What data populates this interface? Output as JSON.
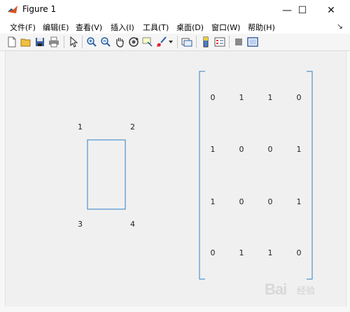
{
  "window": {
    "title": "Figure 1",
    "controls": {
      "minimize": "—",
      "maximize": "☐",
      "close": "✕"
    }
  },
  "menubar": {
    "items": [
      {
        "label": "文件(F)"
      },
      {
        "label": "编辑(E)"
      },
      {
        "label": "查看(V)"
      },
      {
        "label": "插入(I)"
      },
      {
        "label": "工具(T)"
      },
      {
        "label": "桌面(D)"
      },
      {
        "label": "窗口(W)"
      },
      {
        "label": "帮助(H)"
      }
    ],
    "overflow_arrow": "↘"
  },
  "toolbar": {
    "icons": [
      "new-figure-icon",
      "open-file-icon",
      "save-icon",
      "print-icon",
      "select-arrow-icon",
      "zoom-in-icon",
      "zoom-out-icon",
      "pan-hand-icon",
      "rotate-3d-icon",
      "data-cursor-icon",
      "brush-icon",
      "dropdown-icon",
      "link-plot-icon",
      "insert-colorbar-icon",
      "insert-legend-icon",
      "hide-plot-tools-icon",
      "show-plot-tools-icon"
    ]
  },
  "figure": {
    "vertex_labels": [
      "1",
      "2",
      "3",
      "4"
    ],
    "matrix": [
      [
        "0",
        "1",
        "1",
        "0"
      ],
      [
        "1",
        "0",
        "0",
        "1"
      ],
      [
        "1",
        "0",
        "0",
        "1"
      ],
      [
        "0",
        "1",
        "1",
        "0"
      ]
    ],
    "line_color": "#2e7fc4"
  },
  "watermark": {
    "text": "Bai",
    "sub": "经验"
  }
}
